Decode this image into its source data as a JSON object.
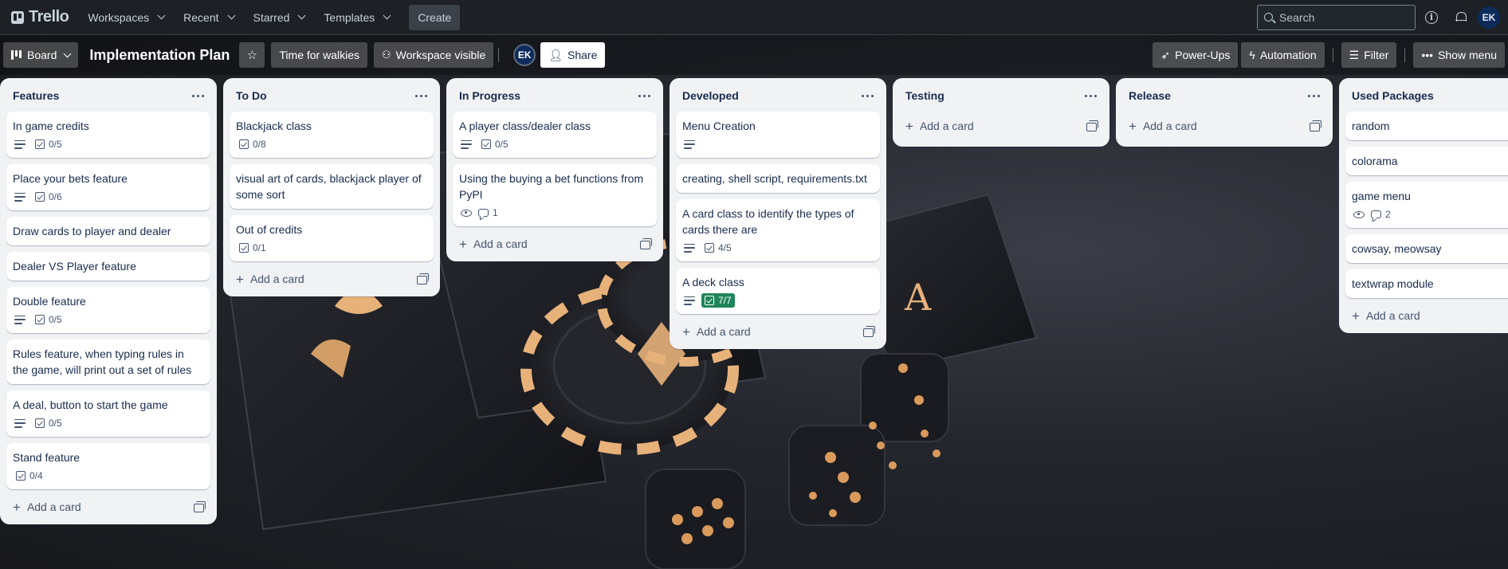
{
  "topbar": {
    "app_name": "Trello",
    "nav": [
      "Workspaces",
      "Recent",
      "Starred",
      "Templates"
    ],
    "create_label": "Create",
    "search_placeholder": "Search",
    "avatar_initials": "EK"
  },
  "boardbar": {
    "view_label": "Board",
    "board_title": "Implementation Plan",
    "workspace_name": "Time for walkies",
    "visibility_label": "Workspace visible",
    "member_initials": "EK",
    "share_label": "Share",
    "powerups_label": "Power-Ups",
    "automation_label": "Automation",
    "filter_label": "Filter",
    "menu_label": "Show menu"
  },
  "add_card_label": "Add a card",
  "colors": {
    "checklist_complete": "#1f845a",
    "list_bg": "#f1f2f4",
    "topbar_bg": "#1d2125"
  },
  "lists": [
    {
      "title": "Features",
      "cards": [
        {
          "title": "In game credits",
          "description": true,
          "checklist": "0/5"
        },
        {
          "title": "Place your bets feature",
          "description": true,
          "checklist": "0/6"
        },
        {
          "title": "Draw cards to player and dealer"
        },
        {
          "title": "Dealer VS Player feature"
        },
        {
          "title": "Double feature",
          "description": true,
          "checklist": "0/5"
        },
        {
          "title": "Rules feature, when typing rules in the game, will print out a set of rules"
        },
        {
          "title": "A deal, button to start the game",
          "description": true,
          "checklist": "0/5"
        },
        {
          "title": "Stand feature",
          "checklist": "0/4"
        }
      ]
    },
    {
      "title": "To Do",
      "cards": [
        {
          "title": "Blackjack class",
          "checklist": "0/8"
        },
        {
          "title": "visual art of cards, blackjack player of some sort"
        },
        {
          "title": "Out of credits",
          "checklist": "0/1"
        }
      ]
    },
    {
      "title": "In Progress",
      "cards": [
        {
          "title": "A player class/dealer class",
          "description": true,
          "checklist": "0/5"
        },
        {
          "title": "Using the buying a bet functions from PyPI",
          "watching": true,
          "comments": "1"
        }
      ]
    },
    {
      "title": "Developed",
      "cards": [
        {
          "title": "Menu Creation",
          "description": true
        },
        {
          "title": "creating, shell script, requirements.txt"
        },
        {
          "title": "A card class to identify the types of cards there are",
          "description": true,
          "checklist": "4/5"
        },
        {
          "title": "A deck class",
          "description": true,
          "checklist": "7/7",
          "complete": true
        }
      ]
    },
    {
      "title": "Testing",
      "cards": []
    },
    {
      "title": "Release",
      "cards": []
    },
    {
      "title": "Used Packages",
      "cards": [
        {
          "title": "random"
        },
        {
          "title": "colorama"
        },
        {
          "title": "game menu",
          "watching": true,
          "comments": "2"
        },
        {
          "title": "cowsay, meowsay"
        },
        {
          "title": "textwrap module"
        }
      ]
    }
  ]
}
